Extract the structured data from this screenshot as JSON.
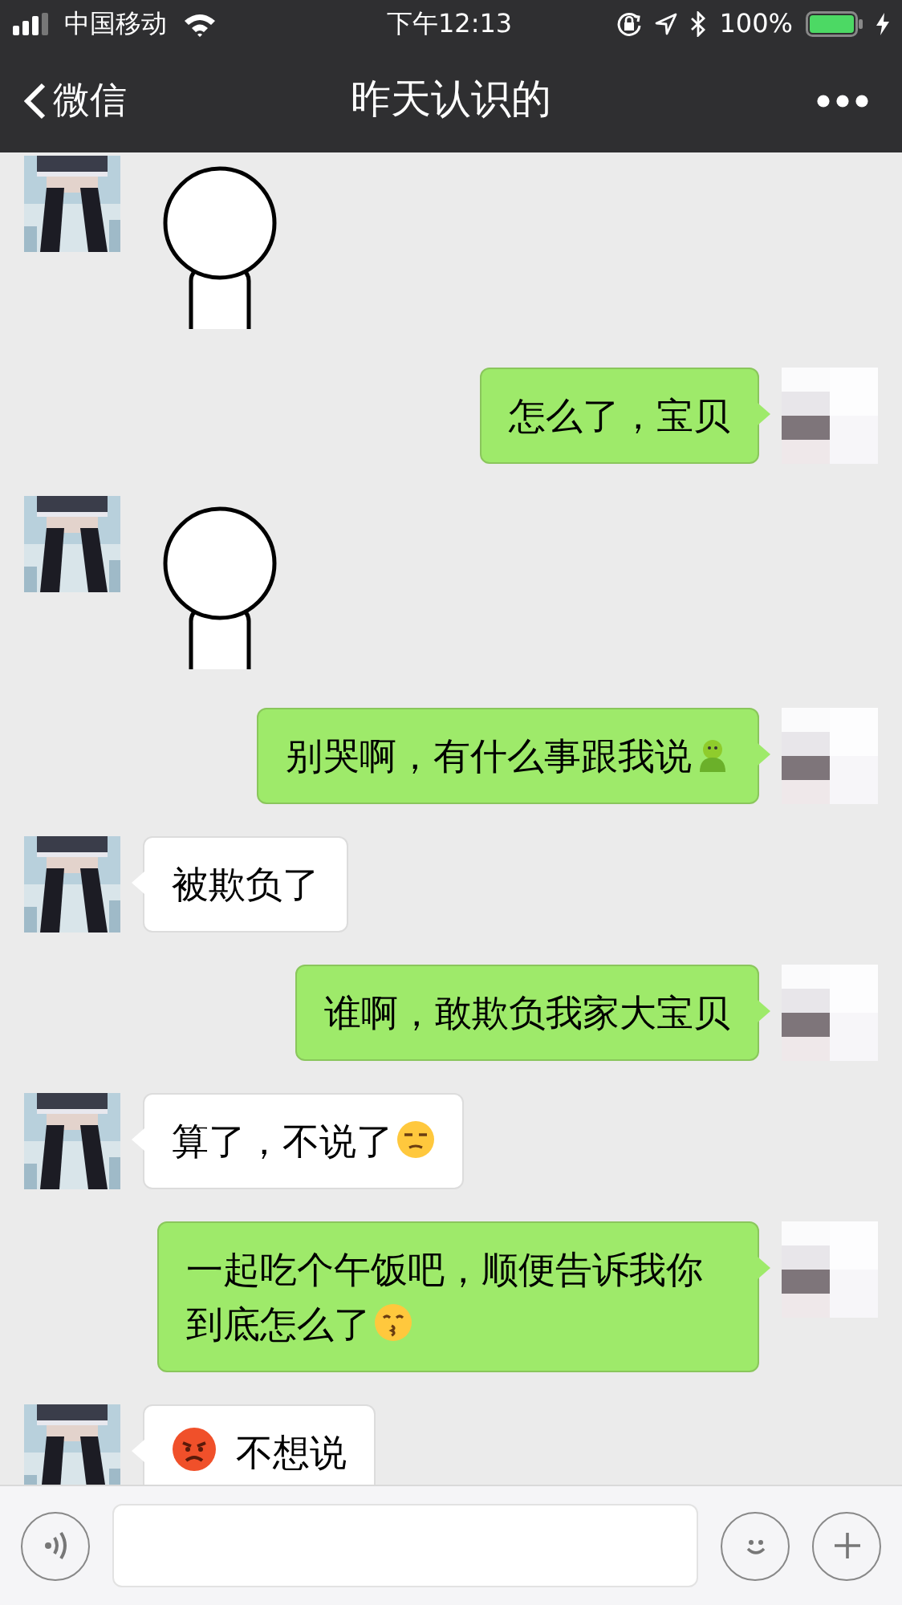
{
  "status_bar": {
    "carrier": "中国移动",
    "time": "下午12:13",
    "battery": "100%"
  },
  "nav": {
    "back": "微信",
    "title": "昨天认识的"
  },
  "messages": [
    {
      "outgoing": false,
      "kind": "sticker"
    },
    {
      "outgoing": true,
      "kind": "text",
      "parts": [
        {
          "kind": "text",
          "text": "怎么了，宝贝"
        }
      ]
    },
    {
      "outgoing": false,
      "kind": "sticker"
    },
    {
      "outgoing": true,
      "kind": "text",
      "parts": [
        {
          "kind": "text",
          "text": "别哭啊，有什么事跟我说"
        },
        {
          "kind": "figure"
        }
      ]
    },
    {
      "outgoing": false,
      "kind": "text",
      "parts": [
        {
          "kind": "text",
          "text": "被欺负了"
        }
      ]
    },
    {
      "outgoing": true,
      "kind": "text",
      "parts": [
        {
          "kind": "text",
          "text": "谁啊，敢欺负我家大宝贝"
        }
      ]
    },
    {
      "outgoing": false,
      "kind": "text",
      "parts": [
        {
          "kind": "text",
          "text": "算了，不说了"
        },
        {
          "kind": "unamused"
        }
      ]
    },
    {
      "outgoing": true,
      "kind": "text",
      "parts": [
        {
          "kind": "text",
          "text": "一起吃个午饭吧，顺便告诉我你到底怎么了"
        },
        {
          "kind": "kiss"
        }
      ]
    },
    {
      "outgoing": false,
      "kind": "text",
      "parts": [
        {
          "kind": "angry"
        },
        {
          "kind": "text",
          "text": "不想说"
        }
      ]
    }
  ]
}
